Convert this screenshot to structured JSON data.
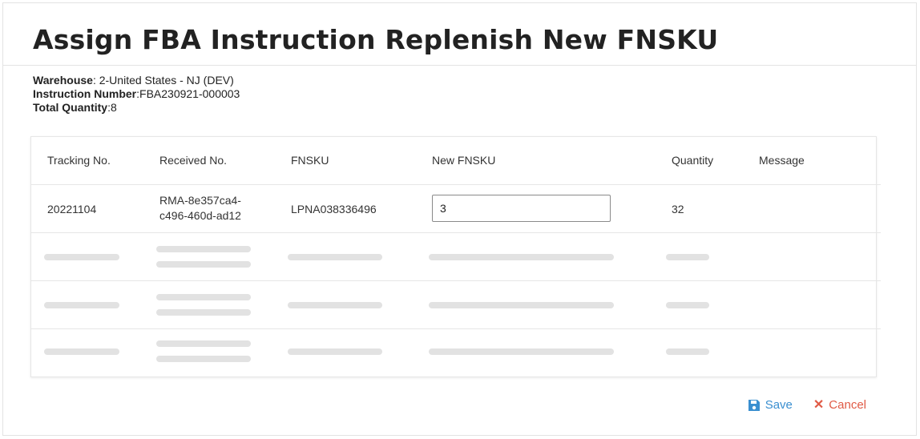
{
  "title": "Assign FBA Instruction Replenish New FNSKU",
  "info": {
    "warehouse_label": "Warehouse",
    "warehouse_value": ": 2-United States - NJ (DEV)",
    "instruction_label": "Instruction Number",
    "instruction_value": ":FBA230921-000003",
    "total_label": "Total Quantity",
    "total_value": ":8"
  },
  "table": {
    "columns": [
      "Tracking No.",
      "Received No.",
      "FNSKU",
      "New FNSKU",
      "Quantity",
      "Message"
    ],
    "rows": [
      {
        "tracking": "20221104",
        "received": "RMA-8e357ca4-c496-460d-ad12",
        "fnsku": "LPNA038336496",
        "new_fnsku": "3",
        "quantity": "32",
        "message": ""
      }
    ]
  },
  "actions": {
    "save": "Save",
    "cancel": "Cancel"
  },
  "colors": {
    "save": "#3a8fd0",
    "cancel": "#e05a45",
    "skeleton": "#e2e2e2"
  },
  "icons": {
    "save": "floppy-disk-icon",
    "cancel": "close-icon"
  }
}
